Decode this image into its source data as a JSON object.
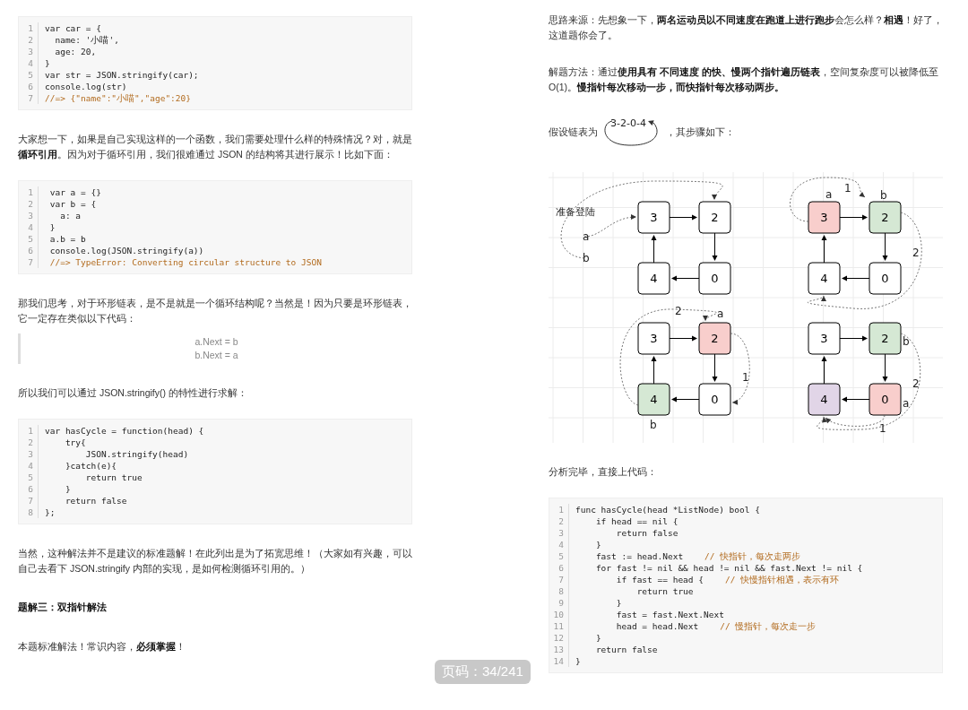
{
  "left_page": {
    "blocks": [
      {
        "kind": "code",
        "lines": [
          {
            "n": "1",
            "code": "var car = {"
          },
          {
            "n": "2",
            "code": "  name: '小喵',"
          },
          {
            "n": "3",
            "code": "  age: 20,"
          },
          {
            "n": "4",
            "code": "}"
          },
          {
            "n": "5",
            "code": "var str = JSON.stringify(car);"
          },
          {
            "n": "6",
            "code": "console.log(str)"
          },
          {
            "n": "7",
            "comment": "//=> {\"name\":\"小喵\",\"age\":20}"
          }
        ]
      },
      {
        "kind": "paragraph",
        "text": "大家想一下，如果是自己实现这样的一个函数，我们需要处理什么样的特殊情况？对，就是**循环引用**。因为对于循环引用，我们很难通过 JSON 的结构将其进行展示！比如下面："
      },
      {
        "kind": "code",
        "lines": [
          {
            "n": "1",
            "code": " var a = {}"
          },
          {
            "n": "2",
            "code": " var b = {"
          },
          {
            "n": "3",
            "code": "   a: a"
          },
          {
            "n": "4",
            "code": " }"
          },
          {
            "n": "5",
            "code": " a.b = b"
          },
          {
            "n": "6",
            "code": " console.log(JSON.stringify(a))"
          },
          {
            "n": "7",
            "comment": " //=> TypeError: Converting circular structure to JSON"
          }
        ]
      },
      {
        "kind": "paragraph",
        "text": "那我们思考，对于环形链表，是不是就是一个循环结构呢？当然是！因为只要是环形链表，它一定存在类似以下代码："
      },
      {
        "kind": "quote",
        "lines": [
          "a.Next = b",
          "b.Next = a"
        ]
      },
      {
        "kind": "paragraph",
        "text": "所以我们可以通过 JSON.stringify() 的特性进行求解："
      },
      {
        "kind": "code",
        "lines": [
          {
            "n": "1",
            "code": "var hasCycle = function(head) {"
          },
          {
            "n": "2",
            "code": "    try{"
          },
          {
            "n": "3",
            "code": "        JSON.stringify(head)"
          },
          {
            "n": "4",
            "code": "    }catch(e){"
          },
          {
            "n": "5",
            "code": "        return true"
          },
          {
            "n": "6",
            "code": "    }"
          },
          {
            "n": "7",
            "code": "    return false"
          },
          {
            "n": "8",
            "code": "};"
          }
        ]
      },
      {
        "kind": "paragraph",
        "text": "当然，这种解法并不是建议的标准题解！在此列出是为了拓宽思维！（大家如有兴趣，可以自己去看下 JSON.stringify 内部的实现，是如何检测循环引用的。）"
      },
      {
        "kind": "heading",
        "text": "题解三：双指针解法"
      },
      {
        "kind": "paragraph",
        "text": "本题标准解法！常识内容，**必须掌握**！"
      }
    ]
  },
  "right_page": {
    "blocks": [
      {
        "kind": "paragraph",
        "text": "思路来源：先想象一下，**两名运动员以不同速度在跑道上进行跑步**会怎么样？**相遇**！好了，这道题你会了。"
      },
      {
        "kind": "paragraph",
        "text": "解题方法：通过**使用具有 不同速度 的快、慢两个指针遍历链表**，空间复杂度可以被降低至 O(1)。**慢指针每次移动一步，而快指针每次移动两步。**"
      },
      {
        "kind": "loop_line",
        "before": "假设链表为",
        "list": "3-2-0-4",
        "after": "，其步骤如下："
      },
      {
        "kind": "diagram",
        "panels": [
          {
            "nodes": [
              {
                "label": "3",
                "color": "#ffffff"
              },
              {
                "label": "2",
                "color": "#ffffff"
              },
              {
                "label": "4",
                "color": "#ffffff"
              },
              {
                "label": "0",
                "color": "#ffffff"
              }
            ],
            "labels": [
              {
                "text": "准备登陆",
                "kind": "note"
              },
              {
                "text": "a",
                "kind": "pointer"
              },
              {
                "text": "b",
                "kind": "pointer"
              }
            ]
          },
          {
            "nodes": [
              {
                "label": "3",
                "color": "#f8cecc"
              },
              {
                "label": "2",
                "color": "#d5e8d4"
              },
              {
                "label": "4",
                "color": "#ffffff"
              },
              {
                "label": "0",
                "color": "#ffffff"
              }
            ],
            "labels": [
              {
                "text": "a",
                "kind": "pointer"
              },
              {
                "text": "1",
                "kind": "step"
              },
              {
                "text": "b",
                "kind": "pointer"
              },
              {
                "text": "2",
                "kind": "step"
              }
            ]
          },
          {
            "nodes": [
              {
                "label": "3",
                "color": "#ffffff"
              },
              {
                "label": "2",
                "color": "#f8cecc"
              },
              {
                "label": "4",
                "color": "#d5e8d4"
              },
              {
                "label": "0",
                "color": "#ffffff"
              }
            ],
            "labels": [
              {
                "text": "2",
                "kind": "step"
              },
              {
                "text": "a",
                "kind": "pointer"
              },
              {
                "text": "1",
                "kind": "step"
              },
              {
                "text": "b",
                "kind": "pointer"
              }
            ]
          },
          {
            "nodes": [
              {
                "label": "3",
                "color": "#ffffff"
              },
              {
                "label": "2",
                "color": "#d5e8d4"
              },
              {
                "label": "4",
                "color": "#e1d5e7"
              },
              {
                "label": "0",
                "color": "#f8cecc"
              }
            ],
            "labels": [
              {
                "text": "b",
                "kind": "pointer"
              },
              {
                "text": "2",
                "kind": "step"
              },
              {
                "text": "a",
                "kind": "pointer"
              },
              {
                "text": "1",
                "kind": "step"
              }
            ]
          }
        ]
      },
      {
        "kind": "paragraph",
        "text": "分析完毕，直接上代码："
      },
      {
        "kind": "code",
        "lines": [
          {
            "n": "1",
            "code": "func hasCycle(head *ListNode) bool {"
          },
          {
            "n": "2",
            "code": "    if head == nil {"
          },
          {
            "n": "3",
            "code": "        return false"
          },
          {
            "n": "4",
            "code": "    }"
          },
          {
            "n": "5",
            "code": "    fast := head.Next",
            "comment": "// 快指针，每次走两步"
          },
          {
            "n": "6",
            "code": "    for fast != nil && head != nil && fast.Next != nil {"
          },
          {
            "n": "7",
            "code": "        if fast == head {",
            "comment": "// 快慢指针相遇，表示有环"
          },
          {
            "n": "8",
            "code": "            return true"
          },
          {
            "n": "9",
            "code": "        }"
          },
          {
            "n": "10",
            "code": "        fast = fast.Next.Next"
          },
          {
            "n": "11",
            "code": "        head = head.Next",
            "comment": "// 慢指针，每次走一步"
          },
          {
            "n": "12",
            "code": "    }"
          },
          {
            "n": "13",
            "code": "    return false"
          },
          {
            "n": "14",
            "code": "}"
          }
        ]
      }
    ]
  },
  "page_indicator": "页码：34/241"
}
